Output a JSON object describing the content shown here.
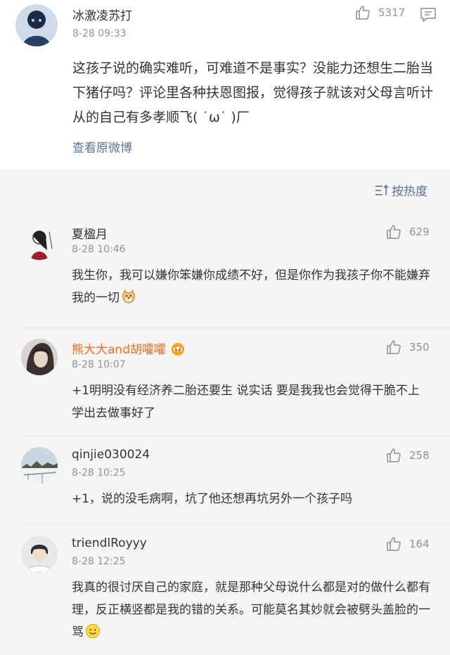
{
  "main_post": {
    "username": "冰激凌苏打",
    "time": "8-28 09:33",
    "likes": "5317",
    "text": "这孩子说的确实难听，可难道不是事实？没能力还想生二胎当下猪仔吗？评论里各种扶恩图报，觉得孩子就该对父母言听计从的自己有多孝顺飞( ˙ω˙ )厂",
    "view_original": "查看原微博"
  },
  "sort": {
    "label": "按热度"
  },
  "comments": [
    {
      "username": "夏楹月",
      "time": "8-28 10:46",
      "likes": "629",
      "text": "我生你，我可以嫌你笨嫌你成绩不好，但是你作为我孩子你不能嫌弃我的一切"
    },
    {
      "username": "熊大大and胡嚯嚯",
      "time": "8-28 10:07",
      "likes": "350",
      "text": "+1明明没有经济养二胎还要生 说实话 要是我我也会觉得干脆不上学出去做事好了"
    },
    {
      "username": "qinjie030024",
      "time": "8-28 10:25",
      "likes": "258",
      "text": "+1，说的没毛病啊，坑了他还想再坑另外一个孩子吗"
    },
    {
      "username": "triendlRoyyy",
      "time": "8-28 12:25",
      "likes": "164",
      "text": "我真的很讨厌自己的家庭，就是那种父母说什么都是对的做什么都有理，反正横竖都是我的错的关系。可能莫名其妙就会被劈头盖脸的一骂"
    }
  ],
  "colors": {
    "link": "#5a7394",
    "vip_name": "#f36c21",
    "meta": "#939393"
  }
}
